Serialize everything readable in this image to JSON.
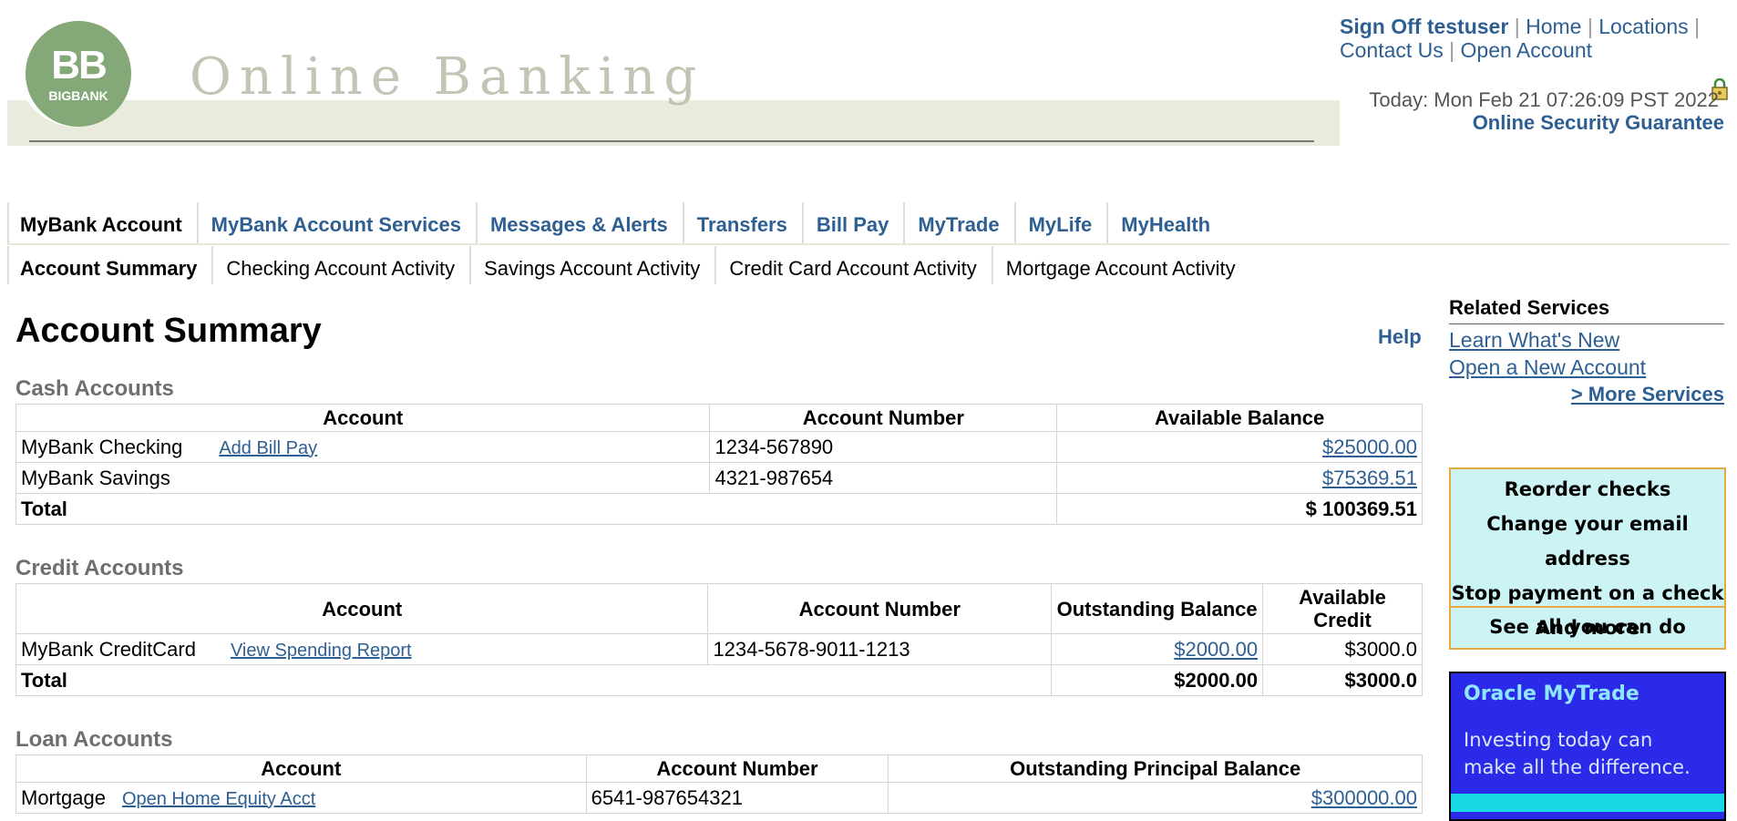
{
  "header": {
    "logo_letters": "BB",
    "logo_name": "BIGBANK",
    "title": "Online Banking",
    "links": {
      "sign_off": "Sign Off testuser",
      "home": "Home",
      "locations": "Locations",
      "contact": "Contact Us",
      "open_account": "Open Account"
    },
    "today": "Today: Mon Feb 21 07:26:09 PST 2022",
    "security": "Online Security Guarantee"
  },
  "main_nav": [
    {
      "label": "MyBank Account",
      "active": true
    },
    {
      "label": "MyBank Account Services",
      "active": false
    },
    {
      "label": "Messages & Alerts",
      "active": false
    },
    {
      "label": "Transfers",
      "active": false
    },
    {
      "label": "Bill Pay",
      "active": false
    },
    {
      "label": "MyTrade",
      "active": false
    },
    {
      "label": "MyLife",
      "active": false
    },
    {
      "label": "MyHealth",
      "active": false
    }
  ],
  "sub_nav": [
    {
      "label": "Account Summary",
      "active": true
    },
    {
      "label": "Checking Account Activity",
      "active": false
    },
    {
      "label": "Savings Account Activity",
      "active": false
    },
    {
      "label": "Credit Card Account Activity",
      "active": false
    },
    {
      "label": "Mortgage Account Activity",
      "active": false
    }
  ],
  "page": {
    "title": "Account Summary",
    "help": "Help"
  },
  "cash": {
    "title": "Cash Accounts",
    "headers": [
      "Account",
      "Account Number",
      "Available Balance"
    ],
    "rows": [
      {
        "account": "MyBank Checking",
        "link": "Add Bill Pay",
        "number": "1234-567890",
        "balance": "$25000.00"
      },
      {
        "account": "MyBank Savings",
        "link": "",
        "number": "4321-987654",
        "balance": "$75369.51"
      }
    ],
    "total_label": "Total",
    "total": "$ 100369.51"
  },
  "credit": {
    "title": "Credit Accounts",
    "headers": [
      "Account",
      "Account Number",
      "Outstanding Balance",
      "Available Credit"
    ],
    "rows": [
      {
        "account": "MyBank CreditCard",
        "link": "View Spending Report",
        "number": "1234-5678-9011-1213",
        "outstanding": "$2000.00",
        "available": "$3000.0"
      }
    ],
    "total_label": "Total",
    "total_outstanding": "$2000.00",
    "total_available": "$3000.0"
  },
  "loan": {
    "title": "Loan Accounts",
    "headers": [
      "Account",
      "Account Number",
      "Outstanding Principal Balance"
    ],
    "rows": [
      {
        "account": "Mortgage",
        "link": "Open Home Equity Acct",
        "number": "6541-987654321",
        "balance": "$300000.00"
      }
    ]
  },
  "related": {
    "title": "Related Services",
    "links": [
      "Learn What's New",
      "Open a New Account"
    ],
    "more": "> More Services"
  },
  "promo": {
    "lines": [
      "Reorder checks",
      "Change your email address",
      "Stop payment on a check",
      "And more"
    ],
    "see_all": "See all you can do"
  },
  "oracle_ad": {
    "title": "Oracle MyTrade",
    "text": "Investing today can make all the difference."
  },
  "colors": {
    "link_blue": "#2e5f93",
    "logo_green": "#84a878",
    "promo_bg": "#ccf4f4",
    "promo_border": "#e8a844",
    "ad_blue": "#2a2ae8"
  }
}
